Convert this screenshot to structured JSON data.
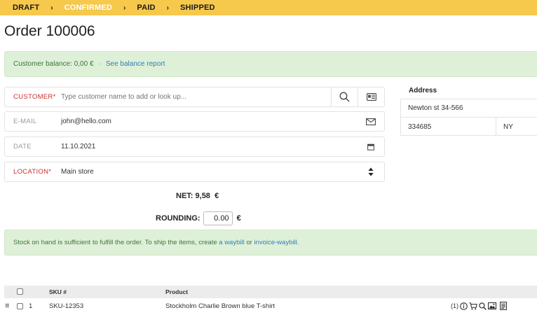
{
  "workflow": {
    "steps": [
      {
        "label": "DRAFT",
        "active": false
      },
      {
        "label": "CONFIRMED",
        "active": true
      },
      {
        "label": "PAID",
        "active": false
      },
      {
        "label": "SHIPPED",
        "active": false
      }
    ]
  },
  "page": {
    "title": "Order 100006"
  },
  "balance": {
    "text": "Customer balance: 0,00 €",
    "separator": "·",
    "link": "See balance report"
  },
  "form": {
    "customer": {
      "label": "CUSTOMER",
      "required_mark": "*",
      "placeholder": "Type customer name to add or look up..."
    },
    "email": {
      "label": "E-MAIL",
      "value": "john@hello.com"
    },
    "date": {
      "label": "DATE",
      "value": "11.10.2021"
    },
    "location": {
      "label": "LOCATION",
      "required_mark": "*",
      "value": "Main store"
    }
  },
  "address": {
    "title": "Address",
    "street": "Newton st 34-566",
    "zip": "334685",
    "state": "NY"
  },
  "totals": {
    "net_label": "NET:",
    "net_value": "9,58",
    "currency": "€",
    "rounding_label": "ROUNDING:",
    "rounding_value": "0.00"
  },
  "stock_notice": {
    "text_before": "Stock on hand is sufficient to fulfill the order. To ship the items, create",
    "link_waybill": "a waybill",
    "or": "or",
    "link_invoice": "invoice-waybill",
    "end": "."
  },
  "table": {
    "columns": {
      "sku": "SKU #",
      "product": "Product"
    },
    "rows": [
      {
        "index": "1",
        "sku": "SKU-12353",
        "product": "Stockholm Charlie Brown blue T-shirt",
        "count": "(1)"
      }
    ]
  },
  "colors": {
    "status_bar": "#f6c84c",
    "success_bg": "#dff0d8",
    "success_text": "#3c763d",
    "link": "#2e7fb8",
    "required": "#c9302c"
  },
  "icons": [
    "search-icon",
    "id-card-icon",
    "envelope-icon",
    "calendar-icon",
    "sort-arrows-icon",
    "drag-handle-icon",
    "info-icon",
    "cart-icon",
    "zoom-icon",
    "image-icon",
    "document-icon"
  ]
}
